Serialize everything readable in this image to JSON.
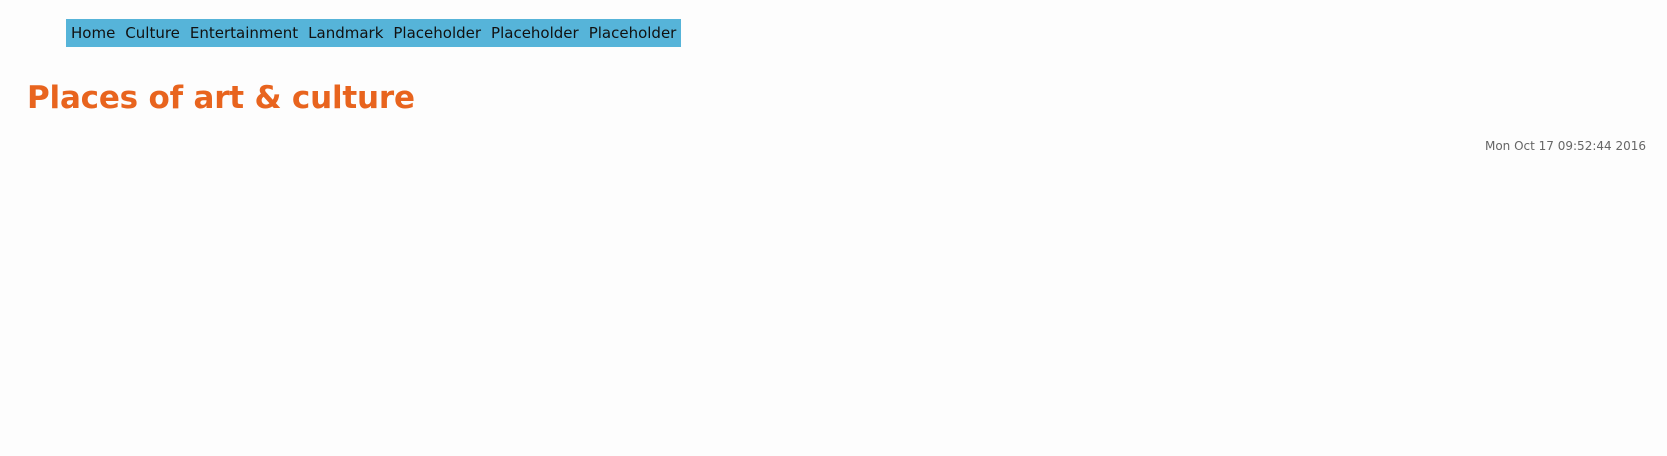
{
  "nav": {
    "items": [
      {
        "label": "Home"
      },
      {
        "label": "Culture"
      },
      {
        "label": "Entertainment"
      },
      {
        "label": "Landmark"
      },
      {
        "label": "Placeholder"
      },
      {
        "label": "Placeholder"
      },
      {
        "label": "Placeholder"
      }
    ]
  },
  "page": {
    "title": "Places of art & culture",
    "timestamp": "Mon Oct 17 09:52:44 2016"
  },
  "colors": {
    "nav_background": "#56b4d9",
    "title": "#e8641e",
    "timestamp": "#666666"
  }
}
